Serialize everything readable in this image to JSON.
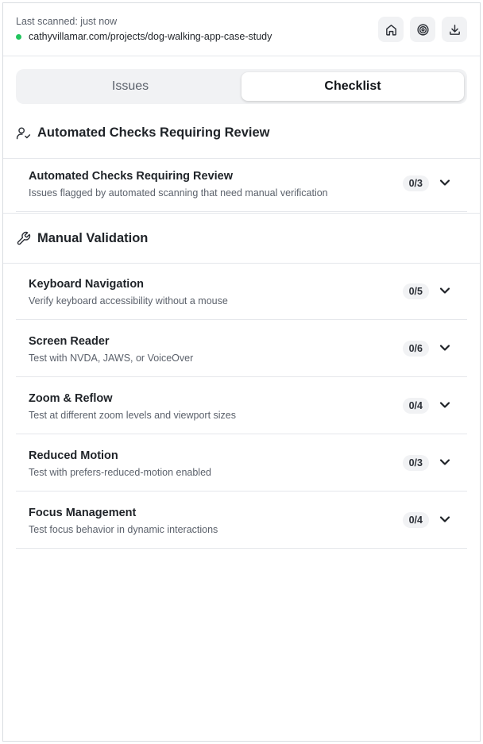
{
  "header": {
    "scan_status": "Last scanned: just now",
    "url": "cathyvillamar.com/projects/dog-walking-app-case-study",
    "status_color": "#22c55e",
    "actions": [
      "home-icon",
      "target-icon",
      "download-icon"
    ]
  },
  "tabs": {
    "issues": "Issues",
    "checklist": "Checklist",
    "active": "Checklist"
  },
  "sections": {
    "automated": {
      "title": "Automated Checks Requiring Review",
      "icon": "user-check-icon",
      "items": [
        {
          "title": "Automated Checks Requiring Review",
          "description": "Issues flagged by automated scanning that need manual verification",
          "count": "0/3"
        }
      ]
    },
    "manual": {
      "title": "Manual Validation",
      "icon": "wrench-icon",
      "items": [
        {
          "title": "Keyboard Navigation",
          "description": "Verify keyboard accessibility without a mouse",
          "count": "0/5"
        },
        {
          "title": "Screen Reader",
          "description": "Test with NVDA, JAWS, or VoiceOver",
          "count": "0/6"
        },
        {
          "title": "Zoom & Reflow",
          "description": "Test at different zoom levels and viewport sizes",
          "count": "0/4"
        },
        {
          "title": "Reduced Motion",
          "description": "Test with prefers-reduced-motion enabled",
          "count": "0/3"
        },
        {
          "title": "Focus Management",
          "description": "Test focus behavior in dynamic interactions",
          "count": "0/4"
        }
      ]
    }
  }
}
